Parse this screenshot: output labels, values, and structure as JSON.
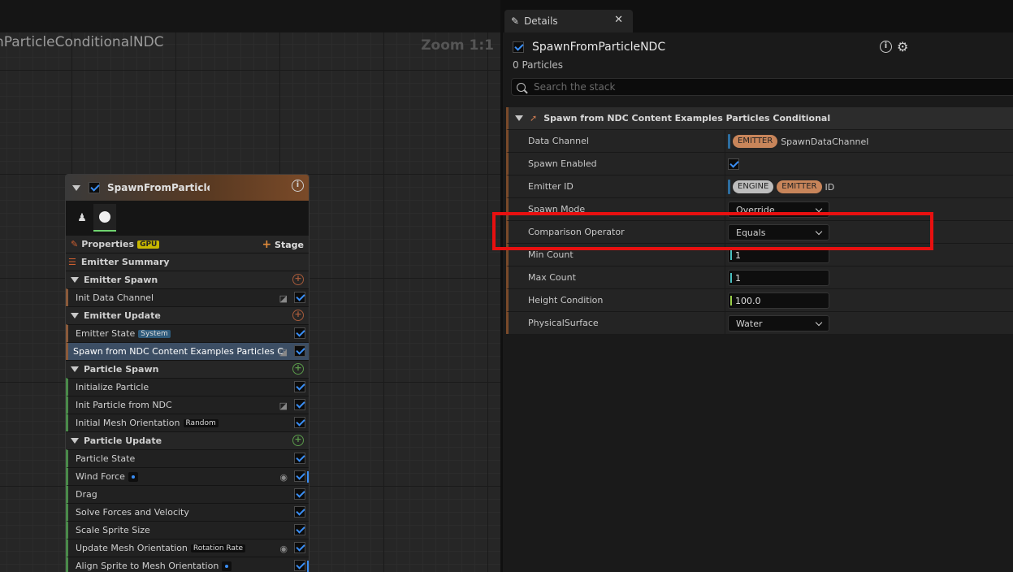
{
  "graph": {
    "title": "nParticleConditionalNDC",
    "zoom": "Zoom 1:1"
  },
  "node": {
    "title": "SpawnFromParticleN",
    "properties_label": "Properties",
    "gpu_tag": "GPU",
    "stage_label": "Stage",
    "rows": [
      {
        "kind": "summary",
        "label": "Emitter Summary"
      },
      {
        "kind": "section",
        "label": "Emitter Spawn",
        "plus": "or"
      },
      {
        "kind": "item",
        "accent": "em",
        "label": "Init Data Channel",
        "icon": true
      },
      {
        "kind": "section",
        "label": "Emitter Update",
        "plus": "or"
      },
      {
        "kind": "item",
        "accent": "em",
        "label": "Emitter State",
        "tag": "System",
        "tagType": "sys"
      },
      {
        "kind": "item",
        "accent": "em",
        "label": "Spawn from NDC Content Examples Particles Conditional",
        "selected": true,
        "icon": true
      },
      {
        "kind": "section",
        "label": "Particle Spawn",
        "plus": "gr"
      },
      {
        "kind": "item",
        "accent": "pa",
        "label": "Initialize Particle"
      },
      {
        "kind": "item",
        "accent": "pa",
        "label": "Init Particle from NDC",
        "icon": true
      },
      {
        "kind": "item",
        "accent": "pa",
        "label": "Initial Mesh Orientation",
        "tag": "Random",
        "tagType": "blk"
      },
      {
        "kind": "section",
        "label": "Particle Update",
        "plus": "gr"
      },
      {
        "kind": "item",
        "accent": "pa",
        "label": "Particle State"
      },
      {
        "kind": "item",
        "accent": "pa",
        "label": "Wind Force",
        "tagType": "dot",
        "eye": true,
        "edge": true
      },
      {
        "kind": "item",
        "accent": "pa",
        "label": "Drag"
      },
      {
        "kind": "item",
        "accent": "pa",
        "label": "Solve Forces and Velocity"
      },
      {
        "kind": "item",
        "accent": "pa",
        "label": "Scale Sprite Size"
      },
      {
        "kind": "item",
        "accent": "pa",
        "label": "Update Mesh Orientation",
        "tag": "Rotation Rate",
        "tagType": "blk",
        "eye": true
      },
      {
        "kind": "item",
        "accent": "pa",
        "label": "Align Sprite to Mesh Orientation",
        "tagType": "dot",
        "edge": true
      }
    ]
  },
  "details": {
    "tab_label": "Details",
    "title": "SpawnFromParticleNDC",
    "count": "0 Particles",
    "search_placeholder": "Search the stack",
    "group_title": "Spawn from NDC Content Examples Particles Conditional",
    "props": [
      {
        "name": "Data Channel",
        "type": "pills",
        "pills": [
          "EMITTER"
        ],
        "text": "SpawnDataChannel"
      },
      {
        "name": "Spawn Enabled",
        "type": "check"
      },
      {
        "name": "Emitter ID",
        "type": "pills",
        "pills": [
          "ENGINE",
          "EMITTER"
        ],
        "text": "ID"
      },
      {
        "name": "Spawn Mode",
        "type": "drop",
        "value": "Override"
      },
      {
        "name": "Comparison Operator",
        "type": "drop",
        "value": "Equals"
      },
      {
        "name": "Min Count",
        "type": "int",
        "value": "1"
      },
      {
        "name": "Max Count",
        "type": "int",
        "value": "1"
      },
      {
        "name": "Height Condition",
        "type": "float",
        "value": "100.0"
      },
      {
        "name": "PhysicalSurface",
        "type": "drop",
        "value": "Water"
      }
    ]
  }
}
